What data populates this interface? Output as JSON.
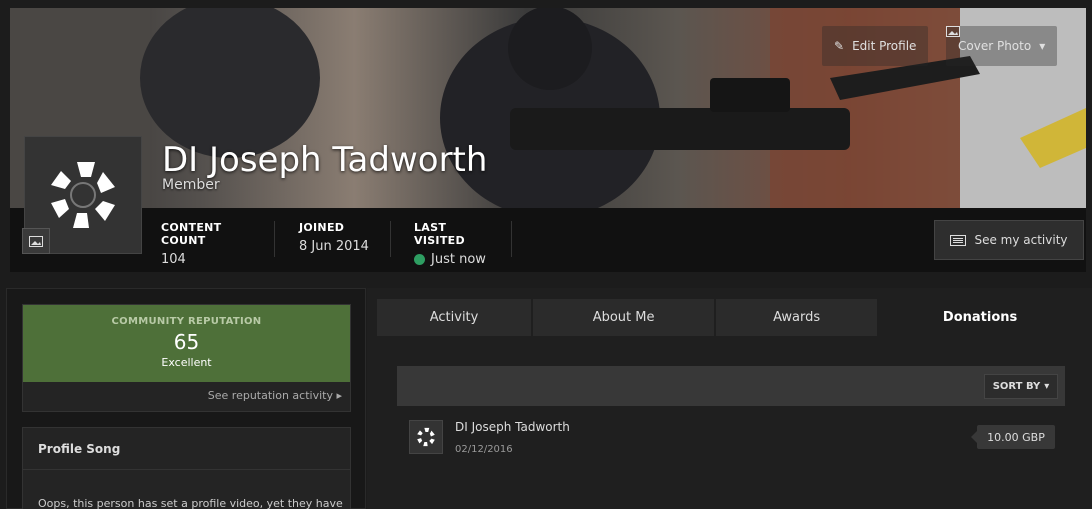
{
  "header": {
    "edit_profile_label": "Edit Profile",
    "cover_photo_label": "Cover Photo",
    "user_name": "DI Joseph Tadworth",
    "user_group": "Member",
    "see_activity_label": "See my activity"
  },
  "stats": [
    {
      "label": "CONTENT COUNT",
      "value": "104"
    },
    {
      "label": "JOINED",
      "value": "8 Jun 2014"
    },
    {
      "label": "LAST VISITED",
      "value": "Just now"
    }
  ],
  "reputation": {
    "title": "COMMUNITY REPUTATION",
    "value": "65",
    "level": "Excellent",
    "link_label": "See reputation activity"
  },
  "profile_song": {
    "title": "Profile Song",
    "text": "Oops, this person has set a profile video, yet they have"
  },
  "tabs": [
    {
      "label": "Activity"
    },
    {
      "label": "About Me"
    },
    {
      "label": "Awards"
    },
    {
      "label": "Donations"
    }
  ],
  "donations": {
    "sort_label": "SORT BY",
    "rows": [
      {
        "name": "DI Joseph Tadworth",
        "date": "02/12/2016",
        "amount": "10.00 GBP"
      }
    ]
  },
  "colors": {
    "reputation_bg": "#4e7039",
    "online_dot": "#2e9e62"
  }
}
